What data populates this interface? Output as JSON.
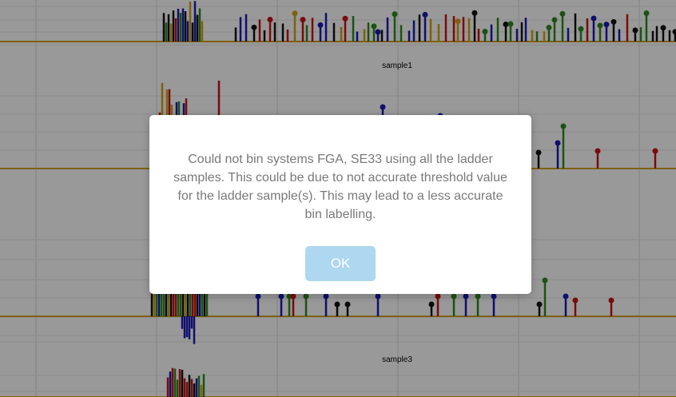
{
  "panels": [
    {
      "label": ""
    },
    {
      "label": "sample1"
    },
    {
      "label": ""
    },
    {
      "label": "sample3"
    }
  ],
  "trace_colors": {
    "blue": "#1a1ab8",
    "green": "#2e8b1e",
    "black": "#111111",
    "red": "#cc1111",
    "orange": "#d4a017"
  },
  "dialog": {
    "message": "Could not bin systems FGA, SE33 using all the ladder samples. This could be due to not accurate threshold value for the ladder sample(s). This may lead to a less accurate bin labelling.",
    "ok_label": "OK",
    "ok_color": "#add8f0"
  }
}
